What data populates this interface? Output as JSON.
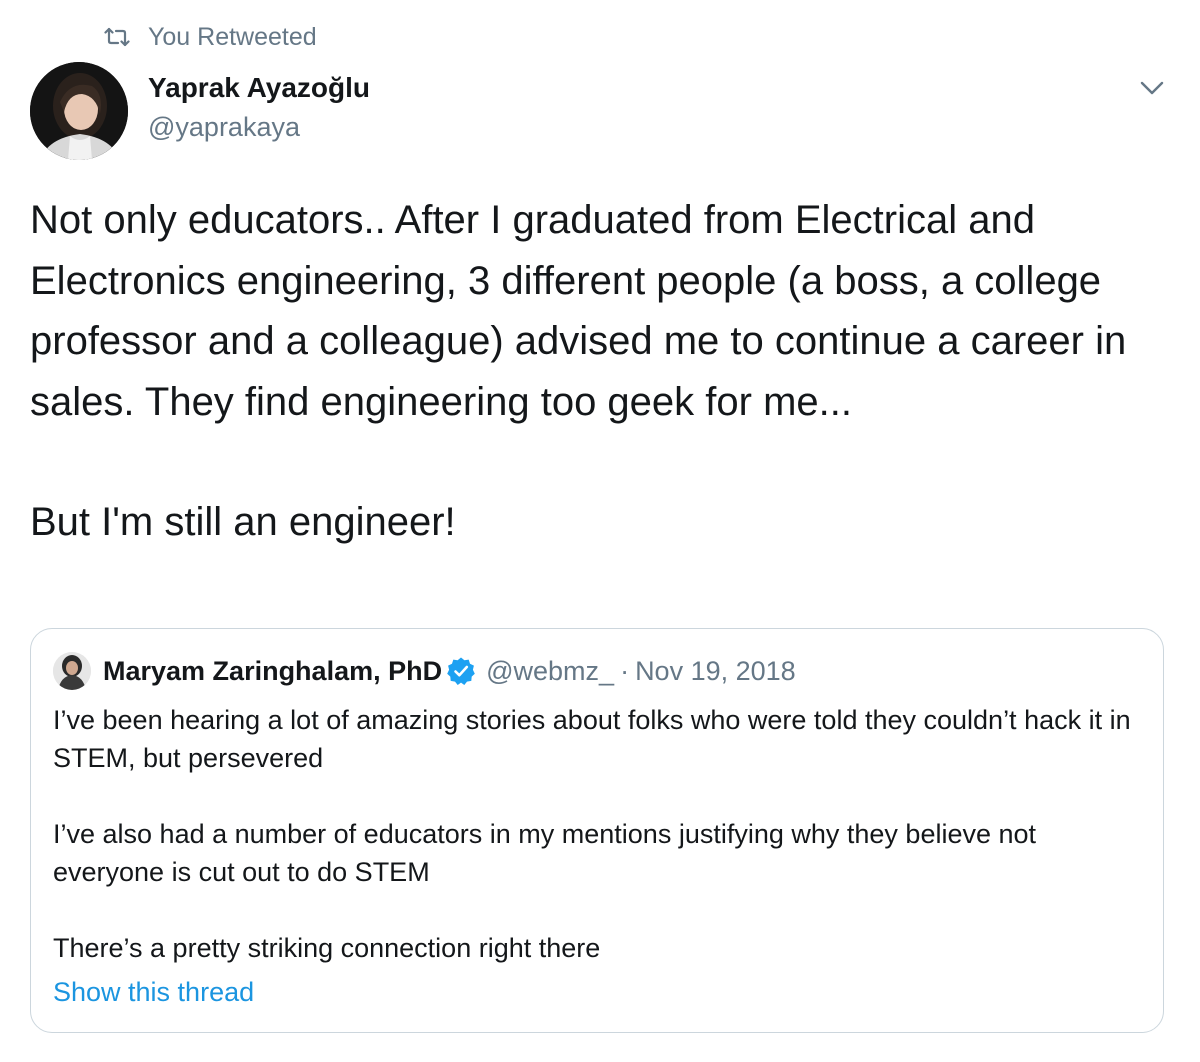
{
  "retweet_context": {
    "icon": "retweet-icon",
    "label": "You Retweeted"
  },
  "tweet": {
    "author": {
      "name": "Yaprak Ayazoğlu",
      "handle": "@yaprakaya",
      "avatar": "avatar"
    },
    "menu_icon": "chevron-down-icon",
    "paragraphs": [
      "Not only educators.. After I graduated from Electrical and Electronics engineering, 3 different people (a boss, a college professor and a colleague) advised me to continue a career in sales. They find engineering too geek for me...",
      "But I'm still an engineer!"
    ]
  },
  "quoted_tweet": {
    "author": {
      "name": "Maryam Zaringhalam, PhD",
      "verified": true,
      "handle": "@webmz_",
      "separator": "·",
      "date": "Nov 19, 2018"
    },
    "paragraphs": [
      "I’ve been hearing a lot of amazing stories about folks who were told they couldn’t hack it in STEM, but persevered",
      "I’ve also had a number of educators in my mentions justifying why they believe not everyone is cut out to do STEM",
      "There’s a pretty striking connection right there"
    ],
    "show_thread_label": "Show this thread"
  },
  "colors": {
    "text": "#14171a",
    "secondary": "#657786",
    "link": "#1b95e0",
    "verified": "#1da1f2",
    "border": "#ccd6dd"
  }
}
